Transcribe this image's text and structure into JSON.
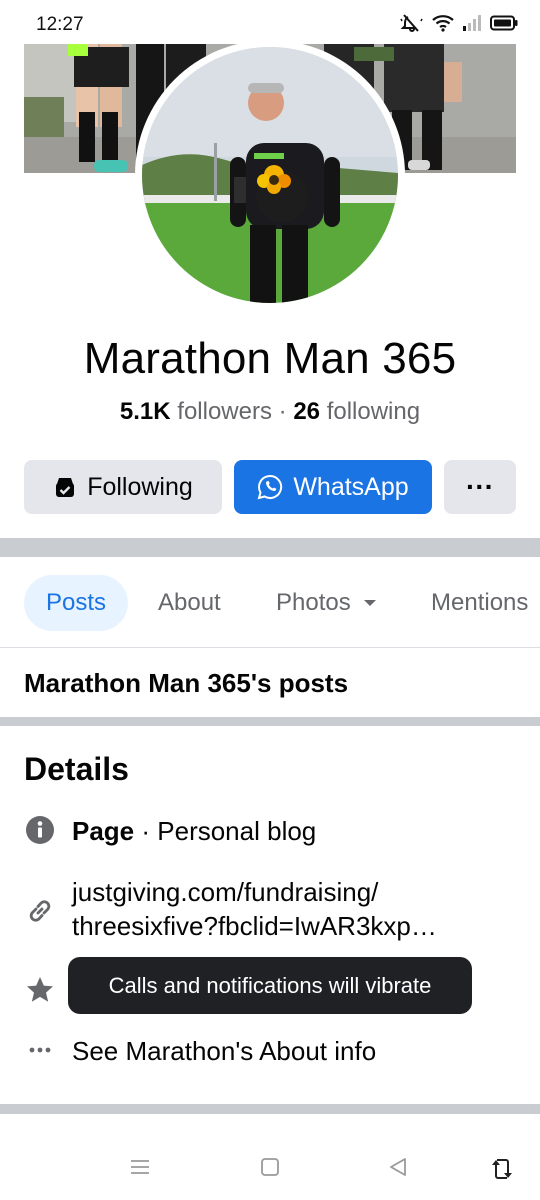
{
  "status": {
    "time": "12:27"
  },
  "profile": {
    "name": "Marathon Man 365",
    "followers_count": "5.1K",
    "followers_label": "followers",
    "separator": " · ",
    "following_count": "26",
    "following_label": "following"
  },
  "actions": {
    "following": "Following",
    "whatsapp": "WhatsApp",
    "more": "···"
  },
  "tabs": [
    "Posts",
    "About",
    "Photos",
    "Mentions"
  ],
  "posts_heading": "Marathon Man 365's posts",
  "details": {
    "title": "Details",
    "category_label": "Page",
    "category_sep": " · ",
    "category_value": "Personal blog",
    "link_line1": "justgiving.com/fundraising/",
    "link_line2": "threesixfive?fbclid=IwAR3kxp…",
    "about_link": "See Marathon's About info"
  },
  "toast": "Calls and notifications will vibrate",
  "colors": {
    "accent": "#1b74e4",
    "tab_active_bg": "#e7f3ff",
    "button_bg": "#e4e6eb",
    "secondary_text": "#65676b",
    "toast_bg": "#202124"
  },
  "icons": [
    "mute-icon",
    "wifi-icon",
    "signal-icon",
    "battery-icon",
    "following-check-icon",
    "whatsapp-icon",
    "chevron-down-icon",
    "info-icon",
    "link-icon",
    "star-icon",
    "more-icon",
    "menu-icon",
    "home-icon",
    "back-icon",
    "rotate-icon"
  ]
}
